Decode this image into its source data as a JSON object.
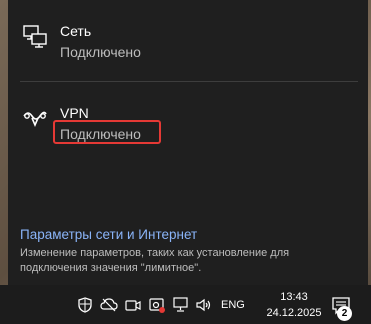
{
  "network_flyout": {
    "ethernet": {
      "name": "Сеть",
      "status": "Подключено",
      "icon": "ethernet-monitor-icon"
    },
    "vpn": {
      "name": "VPN",
      "status": "Подключено",
      "icon": "vpn-icon"
    },
    "settings_link": "Параметры сети и Интернет",
    "settings_description": "Изменение параметров, таких как установление для подключения значения \"лимитное\"."
  },
  "taskbar": {
    "tray_icons": [
      "security-shield-icon",
      "cloud-offline-icon",
      "meet-now-icon",
      "screen-record-icon",
      "network-icon",
      "volume-icon"
    ],
    "language": "ENG",
    "time": "13:43",
    "date": "24.12.2025",
    "notifications_count": "2"
  },
  "colors": {
    "accent": "#8ab4f8",
    "highlight": "#e53935",
    "flyout_bg": "#1f1f1f"
  }
}
